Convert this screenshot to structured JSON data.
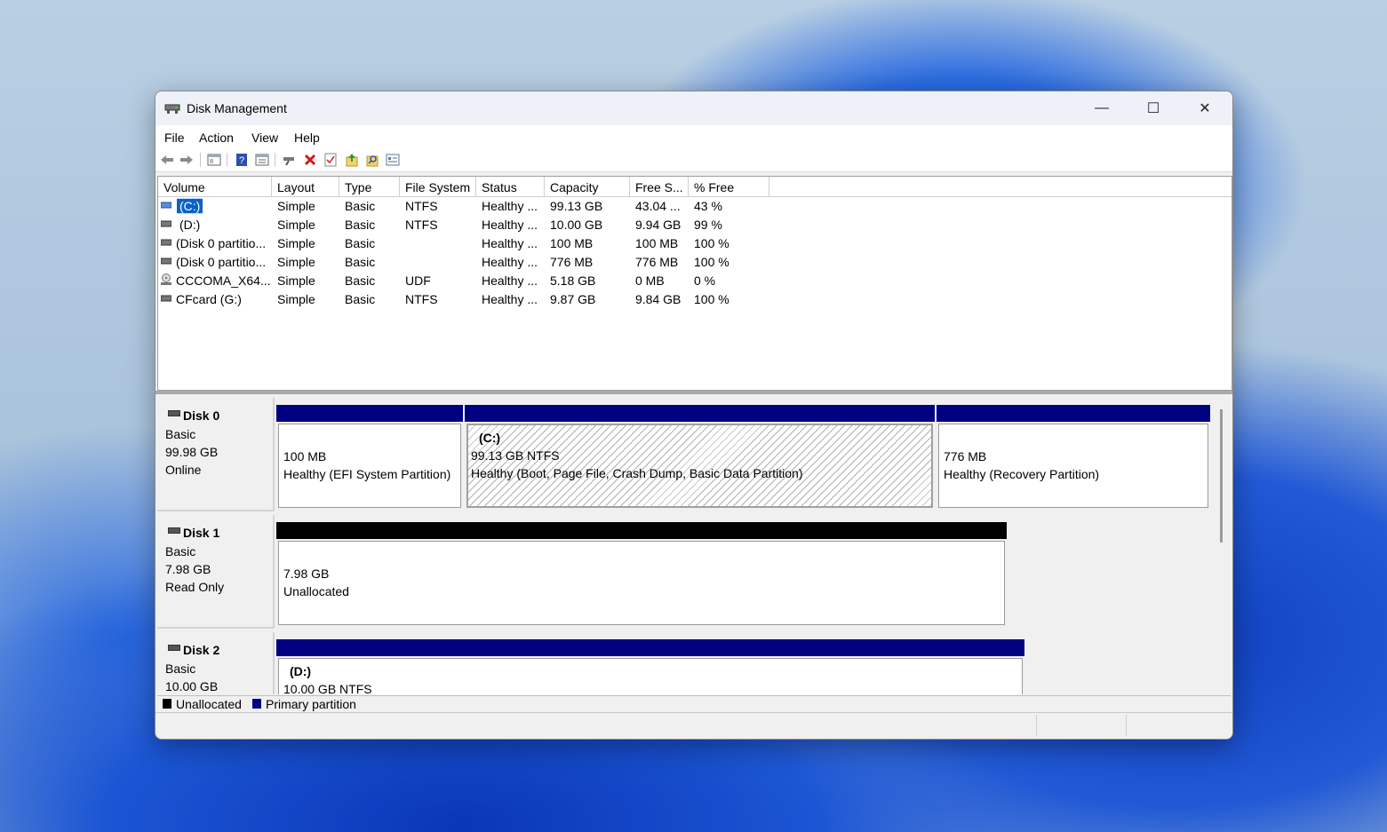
{
  "window": {
    "title": "Disk Management"
  },
  "window_controls": {
    "minimize": "—",
    "maximize": "☐",
    "close": "✕"
  },
  "menu": [
    "File",
    "Action",
    "View",
    "Help"
  ],
  "toolbar": {
    "icons": [
      "back-icon",
      "forward-icon",
      "console-tree-icon",
      "help-icon",
      "properties-icon",
      "connect-icon",
      "delete-icon",
      "check-icon",
      "export-icon",
      "search-icon",
      "info-icon"
    ]
  },
  "volume_list": {
    "columns": [
      "Volume",
      "Layout",
      "Type",
      "File System",
      "Status",
      "Capacity",
      "Free S...",
      "% Free"
    ],
    "rows": [
      {
        "volume": "(C:)",
        "layout": "Simple",
        "type": "Basic",
        "fs": "NTFS",
        "status": "Healthy ...",
        "capacity": "99.13 GB",
        "free": "43.04 ...",
        "pct": "43 %",
        "icon": "drive-icon"
      },
      {
        "volume": "(D:)",
        "layout": "Simple",
        "type": "Basic",
        "fs": "NTFS",
        "status": "Healthy ...",
        "capacity": "10.00 GB",
        "free": "9.94 GB",
        "pct": "99 %",
        "icon": "drive-icon"
      },
      {
        "volume": "(Disk 0 partitio...",
        "layout": "Simple",
        "type": "Basic",
        "fs": "",
        "status": "Healthy ...",
        "capacity": "100 MB",
        "free": "100 MB",
        "pct": "100 %",
        "icon": "drive-icon"
      },
      {
        "volume": "(Disk 0 partitio...",
        "layout": "Simple",
        "type": "Basic",
        "fs": "",
        "status": "Healthy ...",
        "capacity": "776 MB",
        "free": "776 MB",
        "pct": "100 %",
        "icon": "drive-icon"
      },
      {
        "volume": "CCCOMA_X64...",
        "layout": "Simple",
        "type": "Basic",
        "fs": "UDF",
        "status": "Healthy ...",
        "capacity": "5.18 GB",
        "free": "0 MB",
        "pct": "0 %",
        "icon": "cd-drive-icon"
      },
      {
        "volume": "CFcard (G:)",
        "layout": "Simple",
        "type": "Basic",
        "fs": "NTFS",
        "status": "Healthy ...",
        "capacity": "9.87 GB",
        "free": "9.84 GB",
        "pct": "100 %",
        "icon": "drive-icon"
      }
    ]
  },
  "disks": [
    {
      "name": "Disk 0",
      "type": "Basic",
      "size": "99.98 GB",
      "state": "Online",
      "partitions": [
        {
          "title": "",
          "size": "100 MB",
          "status": "Healthy (EFI System Partition)",
          "kind": "primary"
        },
        {
          "title": "(C:)",
          "size": "99.13 GB NTFS",
          "status": "Healthy (Boot, Page File, Crash Dump, Basic Data Partition)",
          "kind": "primary",
          "selected": true
        },
        {
          "title": "",
          "size": "776 MB",
          "status": "Healthy (Recovery Partition)",
          "kind": "primary"
        }
      ]
    },
    {
      "name": "Disk 1",
      "type": "Basic",
      "size": "7.98 GB",
      "state": "Read Only",
      "partitions": [
        {
          "title": "",
          "size": "7.98 GB",
          "status": "Unallocated",
          "kind": "unallocated"
        }
      ]
    },
    {
      "name": "Disk 2",
      "type": "Basic",
      "size": "10.00 GB",
      "state": "",
      "partitions": [
        {
          "title": "(D:)",
          "size": "10.00 GB NTFS",
          "status": "",
          "kind": "primary"
        }
      ]
    }
  ],
  "legend": [
    {
      "label": "Unallocated",
      "color": "#000000"
    },
    {
      "label": "Primary partition",
      "color": "#000080"
    }
  ],
  "colors": {
    "primary": "#000080",
    "unallocated": "#000000",
    "selection": "#0a62c9"
  }
}
